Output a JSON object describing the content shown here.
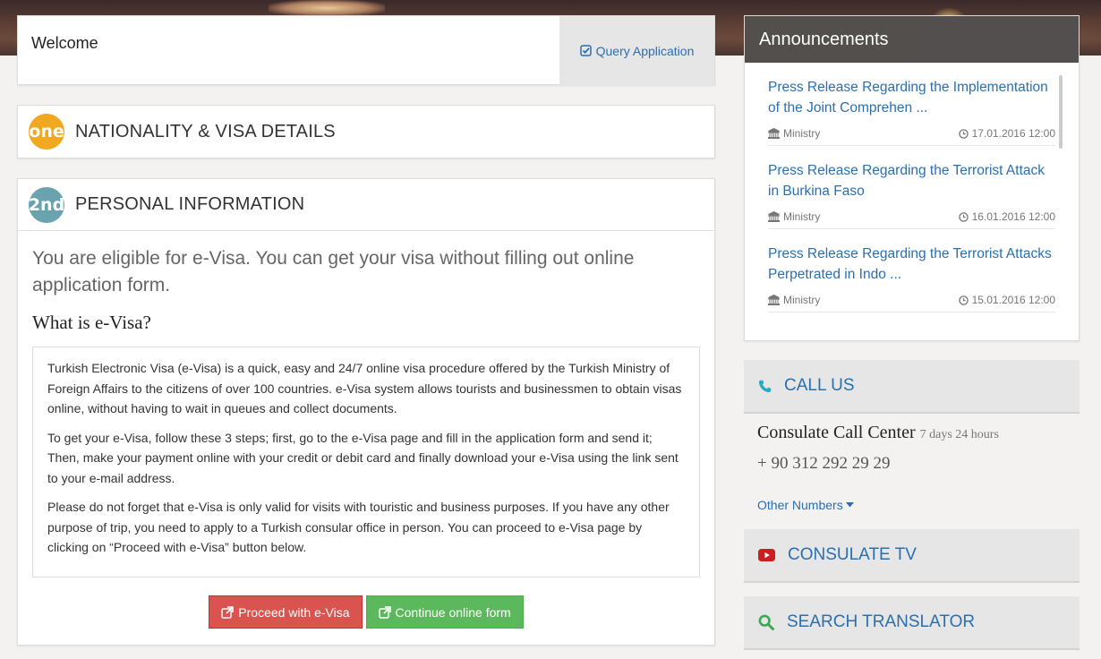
{
  "welcome": {
    "text": "Welcome",
    "query_label": "Query Application"
  },
  "step1": {
    "badge": "one",
    "title": "NATIONALITY & VISA DETAILS"
  },
  "step2": {
    "badge": "2nd",
    "title": "PERSONAL INFORMATION",
    "eligible": "You are eligible for e-Visa. You can get your visa without filling out online application form.",
    "what_title": "What is e-Visa?",
    "paragraphs": [
      "Turkish Electronic Visa (e-Visa) is a quick, easy and 24/7 online visa procedure offered by the Turkish Ministry of Foreign Affairs to the citizens of over 100 countries. e-Visa system allows tourists and businessmen to obtain visas online, without having to wait in queues and collect documents.",
      "To get your e-Visa, follow these 3 steps; first, go to the e-Visa page and fill in the application form and send it; Then, make your payment online with your credit or debit card and finally download your e-Visa using the link sent to your e-mail address.",
      "Please do not forget that e-Visa is only valid for visits with touristic and business purposes. If you have any other purpose of trip, you need to apply to a Turkish consular office in person. You can proceed to e-Visa page by clicking on “Proceed with e-Visa” button below."
    ],
    "proceed_label": "Proceed with e-Visa",
    "continue_label": "Continue online form"
  },
  "announcements": {
    "title": "Announcements",
    "items": [
      {
        "title": "Press Release Regarding the Implementation of the Joint Comprehen ...",
        "source": "Ministry",
        "date": "17.01.2016 12:00"
      },
      {
        "title": "Press Release Regarding the Terrorist Attack in Burkina Faso",
        "source": "Ministry",
        "date": "16.01.2016 12:00"
      },
      {
        "title": "Press Release Regarding the Terrorist Attacks Perpetrated in Indo ...",
        "source": "Ministry",
        "date": "15.01.2016 12:00"
      }
    ]
  },
  "call_us": {
    "title": "CALL US",
    "center": "Consulate Call Center",
    "hours": "7 days 24 hours",
    "phone": "+ 90 312 292 29 29",
    "other_numbers": "Other Numbers"
  },
  "consulate_tv": {
    "title": "CONSULATE TV"
  },
  "search_translator": {
    "title": "SEARCH TRANSLATOR"
  },
  "colors": {
    "link": "#2a6fb0",
    "badge_one": "#f0a81e",
    "badge_two": "#6aa3b0",
    "proceed_button": "#d9534f",
    "continue_button": "#5cb85c",
    "announcements_header": "#4a4644"
  }
}
